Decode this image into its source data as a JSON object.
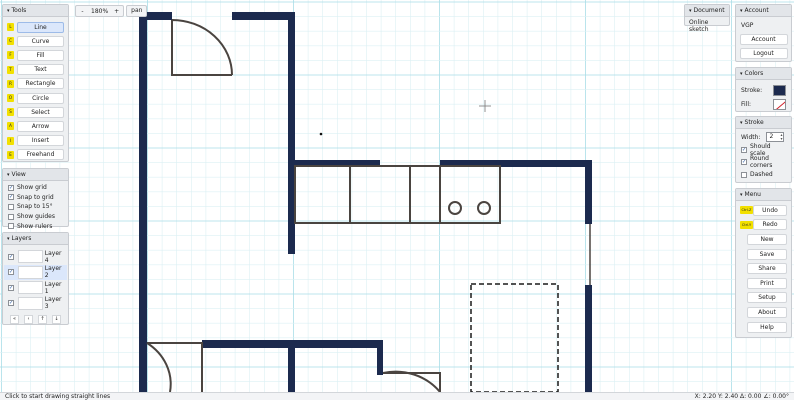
{
  "zoom": {
    "minus": "-",
    "value": "180%",
    "plus": "+",
    "pan": "pan"
  },
  "tools": {
    "title": "Tools",
    "items": [
      {
        "key": "L",
        "label": "Line",
        "active": true
      },
      {
        "key": "C",
        "label": "Curve"
      },
      {
        "key": "F",
        "label": "Fill"
      },
      {
        "key": "T",
        "label": "Text"
      },
      {
        "key": "R",
        "label": "Rectangle"
      },
      {
        "key": "O",
        "label": "Circle"
      },
      {
        "key": "S",
        "label": "Select"
      },
      {
        "key": "A",
        "label": "Arrow"
      },
      {
        "key": "I",
        "label": "Insert"
      },
      {
        "key": "E",
        "label": "Freehand"
      }
    ]
  },
  "view": {
    "title": "View",
    "items": [
      {
        "label": "Show grid",
        "checked": true
      },
      {
        "label": "Snap to grid",
        "checked": true
      },
      {
        "label": "Snap to 15°",
        "checked": false
      },
      {
        "label": "Show guides",
        "checked": false
      },
      {
        "label": "Show rulers",
        "checked": false
      }
    ]
  },
  "layers": {
    "title": "Layers",
    "items": [
      {
        "name": "Layer 4",
        "visible": true
      },
      {
        "name": "Layer 2",
        "visible": true,
        "selected": true
      },
      {
        "name": "Layer 1",
        "visible": true
      },
      {
        "name": "Layer 3",
        "visible": true
      }
    ],
    "controls": [
      "«",
      "‹",
      "↑",
      "↓"
    ]
  },
  "document": {
    "title": "Document",
    "items": [
      "Online sketch"
    ]
  },
  "account": {
    "title": "Account",
    "app": "VGP",
    "buttons": [
      "Account",
      "Logout"
    ]
  },
  "colors": {
    "title": "Colors",
    "stroke_label": "Stroke:",
    "fill_label": "Fill:",
    "stroke_color": "#1c2a4e",
    "fill": "none"
  },
  "stroke": {
    "title": "Stroke",
    "width_label": "Width:",
    "width_value": "2",
    "options": [
      {
        "label": "Should scale",
        "checked": true
      },
      {
        "label": "Round corners",
        "checked": true
      },
      {
        "label": "Dashed",
        "checked": false
      }
    ]
  },
  "menu": {
    "title": "Menu",
    "items": [
      {
        "key": "Ctrl-Z",
        "label": "Undo"
      },
      {
        "key": "Ctrl-Y",
        "label": "Redo"
      },
      {
        "label": "New"
      },
      {
        "label": "Save"
      },
      {
        "label": "Share"
      },
      {
        "label": "Print"
      },
      {
        "label": "Setup"
      },
      {
        "label": "About"
      },
      {
        "label": "Help"
      }
    ]
  },
  "status": {
    "hint": "Click to start drawing straight lines",
    "coords": "X: 2.20 Y: 2.40 Δ: 0.00 ∠: 0.00°"
  },
  "theme": {
    "wall_color": "#1c2a4e",
    "fixture_color": "#4a4440",
    "grid_minor": "#dcf0f4",
    "grid_major": "#a9dde7"
  }
}
